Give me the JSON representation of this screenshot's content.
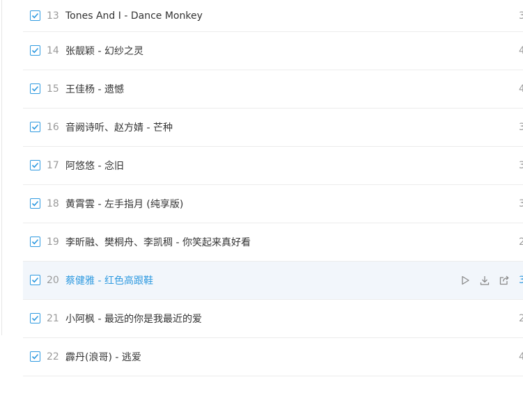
{
  "tracks": [
    {
      "index": "13",
      "title": "Tones And I - Dance Monkey",
      "duration": "3"
    },
    {
      "index": "14",
      "title": "张靓颖 - 幻纱之灵",
      "duration": "4"
    },
    {
      "index": "15",
      "title": "王佳杨 - 遗憾",
      "duration": "4"
    },
    {
      "index": "16",
      "title": "音阙诗听、赵方婧 - 芒种",
      "duration": "3"
    },
    {
      "index": "17",
      "title": "阿悠悠 - 念旧",
      "duration": "3"
    },
    {
      "index": "18",
      "title": "黄霄雲 - 左手指月 (纯享版)",
      "duration": "3"
    },
    {
      "index": "19",
      "title": "李昕融、樊桐舟、李凯稠 - 你笑起来真好看",
      "duration": "2"
    },
    {
      "index": "20",
      "title": "蔡健雅 - 红色高跟鞋",
      "duration": "3"
    },
    {
      "index": "21",
      "title": "小阿枫 - 最远的你是我最近的爱",
      "duration": "2"
    },
    {
      "index": "22",
      "title": "霹丹(浪哥) - 逃爱",
      "duration": "4"
    }
  ],
  "active_index": 7,
  "colors": {
    "accent": "#2f9ae0",
    "text": "#333333",
    "muted": "#9a9a9a",
    "row_hover": "#f2f6fb"
  },
  "icons": {
    "checkbox": "checkbox-checked-icon",
    "play": "play-icon",
    "download": "download-icon",
    "share": "share-icon"
  }
}
